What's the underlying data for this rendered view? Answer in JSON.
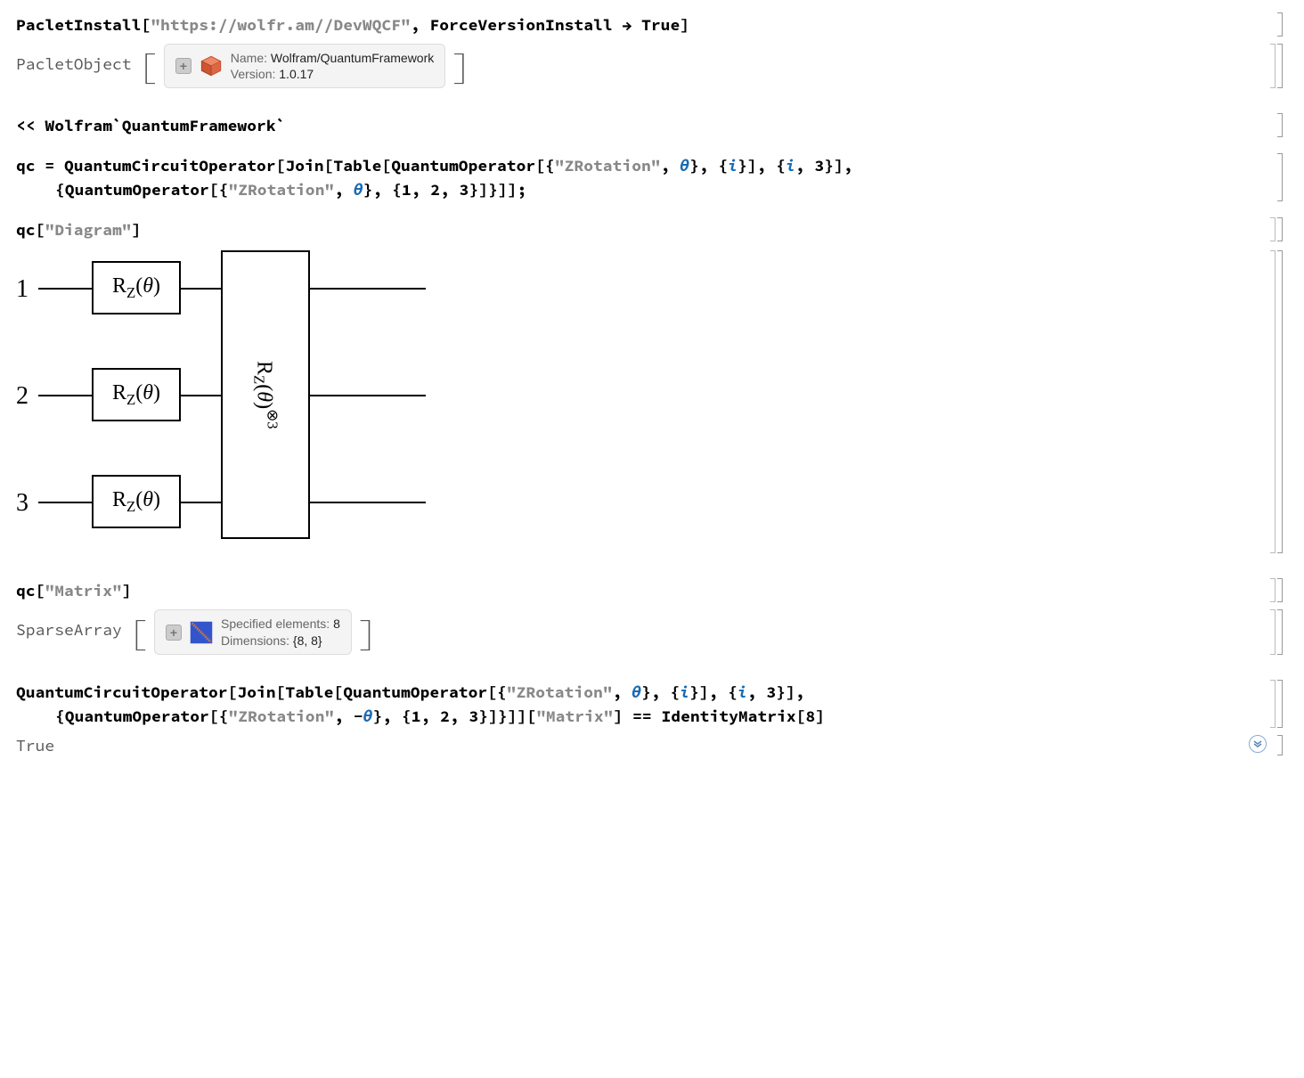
{
  "cells": {
    "install": {
      "fn": "PacletInstall",
      "url": "\"https://wolfr.am//DevWQCF\"",
      "opt_key": "ForceVersionInstall",
      "arrow": "→",
      "opt_val": "True"
    },
    "paclet": {
      "head": "PacletObject",
      "name_label": "Name:",
      "name_value": "Wolfram/QuantumFramework",
      "version_label": "Version:",
      "version_value": "1.0.17"
    },
    "load": {
      "text": "<< Wolfram`QuantumFramework`"
    },
    "qc_def": {
      "line1_a": "qc = QuantumCircuitOperator[Join[Table[QuantumOperator[{",
      "line1_str": "\"ZRotation\"",
      "line1_b": ", ",
      "line1_theta": "θ",
      "line1_c": "}, {",
      "line1_i": "i",
      "line1_d": "}], {",
      "line1_i2": "i",
      "line1_e": ", 3}],",
      "line2_a": "{QuantumOperator[{",
      "line2_str": "\"ZRotation\"",
      "line2_b": ", ",
      "line2_theta": "θ",
      "line2_c": "}, {1, 2, 3}]}]];"
    },
    "diagram_call": {
      "head": "qc[",
      "arg": "\"Diagram\"",
      "tail": "]"
    },
    "diagram": {
      "labels": [
        "1",
        "2",
        "3"
      ],
      "gate_single": "R_Z(θ)",
      "gate_multi": "R_Z(θ)⊗3"
    },
    "matrix_call": {
      "head": "qc[",
      "arg": "\"Matrix\"",
      "tail": "]"
    },
    "sparse": {
      "head": "SparseArray",
      "elem_label": "Specified elements:",
      "elem_value": "8",
      "dim_label": "Dimensions:",
      "dim_value": "{8, 8}"
    },
    "final": {
      "line1_a": "QuantumCircuitOperator[Join[Table[QuantumOperator[{",
      "line1_str": "\"ZRotation\"",
      "line1_b": ", ",
      "line1_theta": "θ",
      "line1_c": "}, {",
      "line1_i": "i",
      "line1_d": "}], {",
      "line1_i2": "i",
      "line1_e": ", 3}],",
      "line2_a": "{QuantumOperator[{",
      "line2_str": "\"ZRotation\"",
      "line2_b": ", -",
      "line2_theta": "θ",
      "line2_c": "}, {1, 2, 3}]}]][",
      "line2_mat": "\"Matrix\"",
      "line2_d": "] == IdentityMatrix[8]"
    },
    "true_out": "True"
  }
}
